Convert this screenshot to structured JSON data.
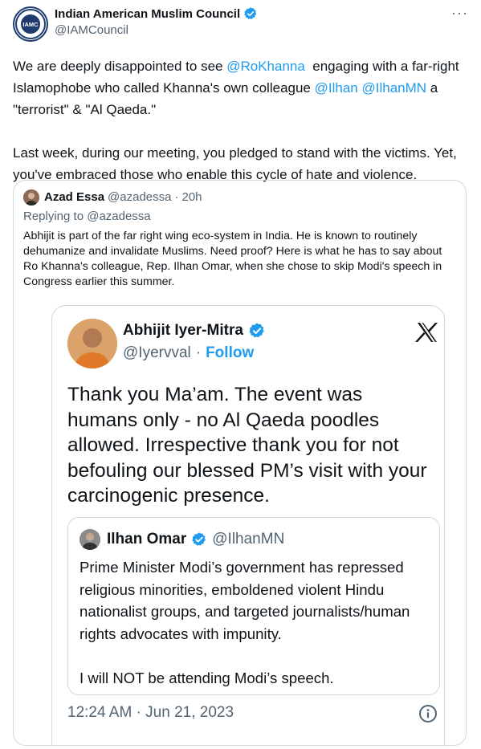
{
  "author": {
    "display_name": "Indian American Muslim Council",
    "handle": "@IAMCouncil",
    "avatar_text": "IAMC"
  },
  "more_label": "···",
  "tweet": {
    "parts": [
      "We are deeply disappointed to see ",
      "@RoKhanna",
      "  engaging with a far-right Islamophobe who called Khanna's own colleague ",
      "@Ilhan",
      " ",
      "@IlhanMN",
      " a \"terrorist\" & \"Al Qaeda.\"\n\nLast week, during our meeting, you pledged to stand with the victims. Yet, you've embraced those who enable this cycle of hate and violence."
    ]
  },
  "quote": {
    "display_name": "Azad Essa",
    "handle": "@azadessa",
    "separator": "·",
    "time": "20h",
    "replying_to": "Replying to @azadessa",
    "text": "Abhijit is part of the far right wing eco-system in India. He is known to routinely dehumanize and invalidate Muslims. Need proof? Here is what he has to say about Ro Khanna's colleague, Rep. Ilhan Omar, when she chose to skip Modi's speech in Congress earlier this summer."
  },
  "screenshot": {
    "display_name": "Abhijit Iyer-Mitra",
    "handle": "@Iyervval",
    "separator": "·",
    "follow_label": "Follow",
    "text": "Thank you Ma’am. The event was humans only - no Al Qaeda poodles allowed. Irrespective thank you for not befouling our blessed PM’s visit with your carcinogenic presence.",
    "timestamp": "12:24 AM · Jun 21, 2023",
    "inner_quote": {
      "display_name": "Ilhan Omar",
      "handle": "@IlhanMN",
      "text": "Prime Minister Modi’s government has repressed religious minorities, emboldened violent Hindu nationalist groups, and targeted journalists/human rights advocates with impunity.\n\nI will NOT be attending Modi’s speech."
    }
  },
  "colors": {
    "accent": "#1d9bf0",
    "verified": "#1d9bf0",
    "muted": "#536471",
    "border": "#cfd9de"
  }
}
